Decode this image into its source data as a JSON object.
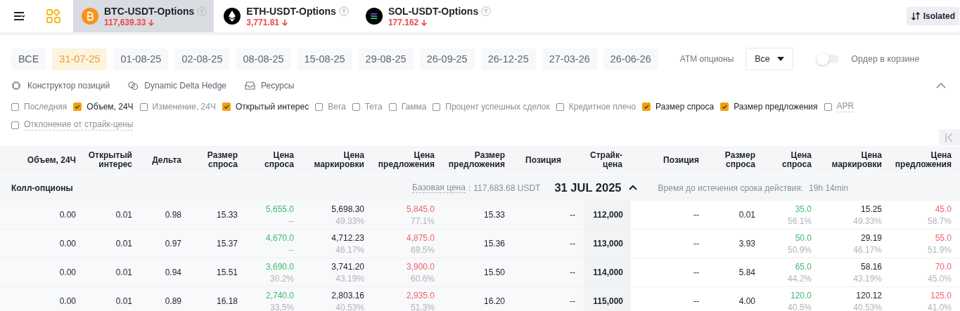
{
  "topbar": {
    "tabs": [
      {
        "name": "BTC-USDT-Options",
        "price": "117,639.33",
        "falling": true,
        "kind": "btc",
        "selected": true
      },
      {
        "name": "ETH-USDT-Options",
        "price": "3,771.81",
        "falling": true,
        "kind": "eth",
        "selected": false
      },
      {
        "name": "SOL-USDT-Options",
        "price": "177.162",
        "falling": true,
        "kind": "sol",
        "selected": false
      }
    ],
    "margin_mode": "Isolated"
  },
  "expiries": [
    {
      "label": "ВСЕ",
      "selected": false
    },
    {
      "label": "31-07-25",
      "selected": true
    },
    {
      "label": "01-08-25",
      "selected": false
    },
    {
      "label": "02-08-25",
      "selected": false
    },
    {
      "label": "08-08-25",
      "selected": false
    },
    {
      "label": "15-08-25",
      "selected": false
    },
    {
      "label": "29-08-25",
      "selected": false
    },
    {
      "label": "26-09-25",
      "selected": false
    },
    {
      "label": "26-12-25",
      "selected": false
    },
    {
      "label": "27-03-26",
      "selected": false
    },
    {
      "label": "26-06-26",
      "selected": false
    }
  ],
  "atm": {
    "label": "ATM опционы",
    "value": "Все"
  },
  "basket_order": {
    "label": "Ордер в корзине",
    "on": false
  },
  "tools": [
    {
      "kind": "builder",
      "label": "Конструктор позиций"
    },
    {
      "kind": "hedge",
      "label": "Dynamic Delta Hedge"
    },
    {
      "kind": "resources",
      "label": "Ресурсы"
    }
  ],
  "column_options": [
    {
      "label": "Последняя",
      "checked": false,
      "hint": false
    },
    {
      "label": "Объем, 24Ч",
      "checked": true,
      "hint": false
    },
    {
      "label": "Изменение, 24Ч",
      "checked": false,
      "hint": false
    },
    {
      "label": "Открытый интерес",
      "checked": true,
      "hint": false
    },
    {
      "label": "Вега",
      "checked": false,
      "hint": false
    },
    {
      "label": "Тета",
      "checked": false,
      "hint": false
    },
    {
      "label": "Гамма",
      "checked": false,
      "hint": false
    },
    {
      "label": "Процент успешных сделок",
      "checked": false,
      "hint": false
    },
    {
      "label": "Кредитное плечо",
      "checked": false,
      "hint": false
    },
    {
      "label": "Размер спроса",
      "checked": true,
      "hint": false
    },
    {
      "label": "Размер предложения",
      "checked": true,
      "hint": false
    },
    {
      "label": "APR",
      "checked": false,
      "hint": true
    },
    {
      "label": "Отклонение от страйк-цены",
      "checked": false,
      "hint": true
    }
  ],
  "table": {
    "columns": [
      {
        "label": "Объем, 24Ч",
        "kind": "num"
      },
      {
        "label": "Открытый интерес",
        "kind": "num"
      },
      {
        "label": "Дельта",
        "kind": "num"
      },
      {
        "label": "Размер спроса",
        "kind": "num"
      },
      {
        "label": "Цена спроса",
        "kind": "bid"
      },
      {
        "label": "Цена маркировки",
        "kind": "mark"
      },
      {
        "label": "Цена предложения",
        "kind": "ask"
      },
      {
        "label": "Размер предложения",
        "kind": "num"
      },
      {
        "label": "Позиция",
        "kind": "num"
      },
      {
        "label": "Страйк-цена",
        "kind": "strike"
      },
      {
        "label": "Позиция",
        "kind": "num"
      },
      {
        "label": "Размер спроса",
        "kind": "num"
      },
      {
        "label": "Цена спроса",
        "kind": "bid"
      },
      {
        "label": "Цена маркировки",
        "kind": "mark"
      },
      {
        "label": "Цена предложения",
        "kind": "ask"
      }
    ],
    "call_section": {
      "title": "Колл-опционы",
      "base_price_label": "Базовая цена",
      "separator": ":",
      "base_price": "117,683.68 USDT",
      "expiry": "31 JUL 2025",
      "expanded": true,
      "time_label": "Время до истечения срока действия:",
      "time_left": "19h 14min"
    },
    "rows": [
      {
        "cells": [
          "0.00",
          "0.01",
          "0.98",
          "15.33",
          {
            "value": "5,655.0",
            "sub": "--"
          },
          {
            "value": "5,698.30",
            "sub": "49.33%"
          },
          {
            "value": "5,845.0",
            "sub": "77.1%"
          },
          "15.33",
          "--",
          "112,000",
          "--",
          "0.01",
          {
            "value": "35.0",
            "sub": "56.1%"
          },
          {
            "value": "15.25",
            "sub": "49.33%"
          },
          {
            "value": "45.0",
            "sub": "58.7%"
          }
        ]
      },
      {
        "cells": [
          "0.00",
          "0.01",
          "0.97",
          "15.37",
          {
            "value": "4,670.0",
            "sub": "--"
          },
          {
            "value": "4,712.23",
            "sub": "46.17%"
          },
          {
            "value": "4,875.0",
            "sub": "69.5%"
          },
          "15.36",
          "--",
          "113,000",
          "--",
          "3.93",
          {
            "value": "50.0",
            "sub": "50.9%"
          },
          {
            "value": "29.19",
            "sub": "46.17%"
          },
          {
            "value": "55.0",
            "sub": "51.9%"
          }
        ]
      },
      {
        "cells": [
          "0.00",
          "0.01",
          "0.94",
          "15.51",
          {
            "value": "3,690.0",
            "sub": "30.2%"
          },
          {
            "value": "3,741.20",
            "sub": "43.19%"
          },
          {
            "value": "3,900.0",
            "sub": "60.6%"
          },
          "15.50",
          "--",
          "114,000",
          "--",
          "5.84",
          {
            "value": "65.0",
            "sub": "44.2%"
          },
          {
            "value": "58.16",
            "sub": "43.19%"
          },
          {
            "value": "70.0",
            "sub": "45.0%"
          }
        ]
      },
      {
        "cells": [
          "0.00",
          "0.01",
          "0.89",
          "16.18",
          {
            "value": "2,740.0",
            "sub": "33.5%"
          },
          {
            "value": "2,803.16",
            "sub": "40.53%"
          },
          {
            "value": "2,935.0",
            "sub": "51.3%"
          },
          "16.20",
          "--",
          "115,000",
          "--",
          "4.00",
          {
            "value": "120.0",
            "sub": "40.5%"
          },
          {
            "value": "120.12",
            "sub": "40.53%"
          },
          {
            "value": "125.0",
            "sub": "41.0%"
          }
        ]
      }
    ]
  }
}
